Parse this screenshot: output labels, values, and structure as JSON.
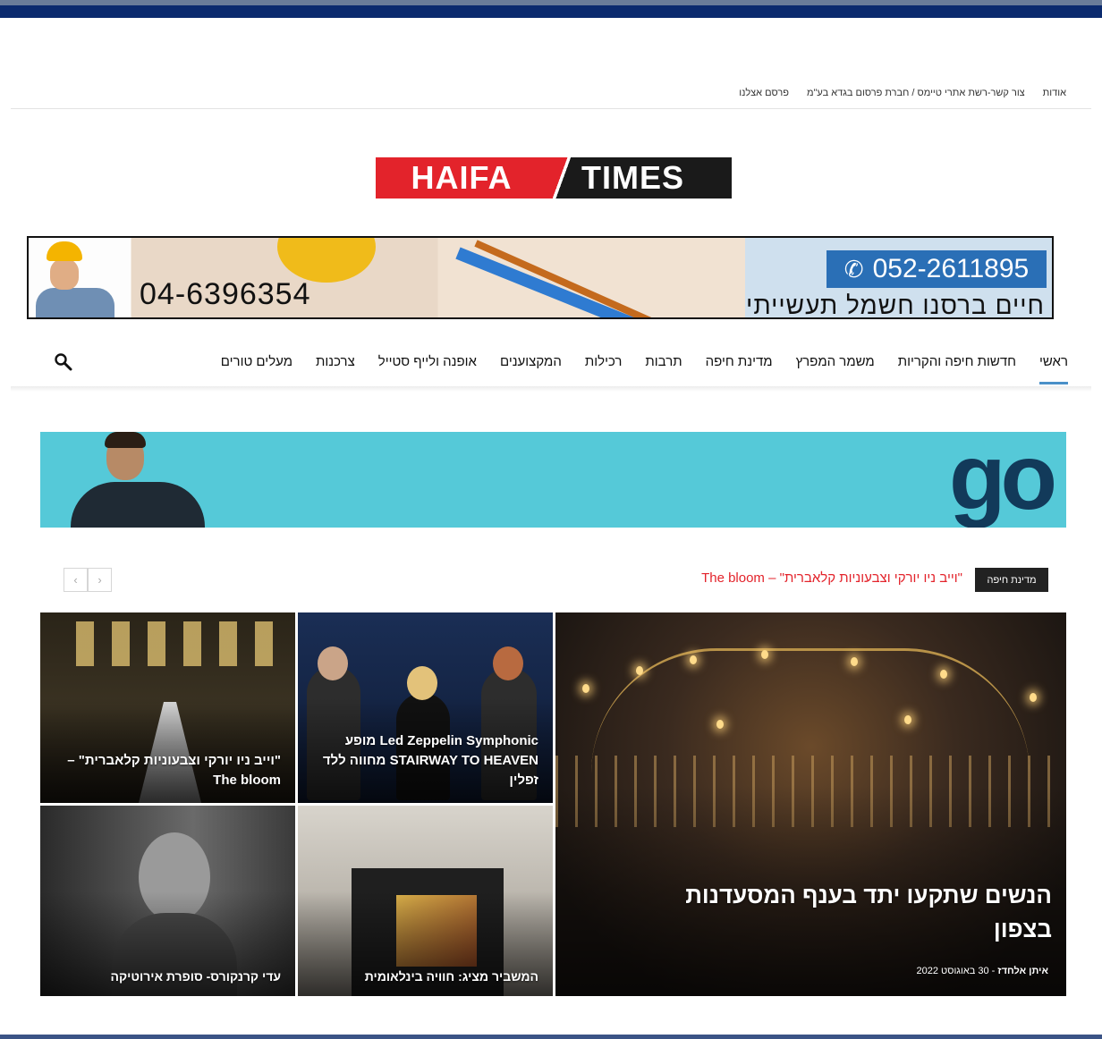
{
  "topmenu": {
    "items": [
      "אודות",
      "צור קשר-רשת אתרי טיימס / חברת פרסום בגדא בע\"מ",
      "פרסם אצלנו"
    ]
  },
  "logo": {
    "left": "HAIFA",
    "right": "TIMES"
  },
  "banner_electric": {
    "phone_left": "04-6396354",
    "phone_right": "052-2611895",
    "name": "חיים ברסנו חשמל תעשייתי"
  },
  "nav": {
    "items": [
      "ראשי",
      "חדשות חיפה והקריות",
      "משמר המפרץ",
      "מדינת חיפה",
      "תרבות",
      "רכילות",
      "המקצוענים",
      "אופנה ולייף סטייל",
      "צרכנות",
      "מעלים טורים"
    ],
    "active_index": 0
  },
  "banner_go": {
    "logo": "go"
  },
  "ticker": {
    "badge": "מדינת חיפה",
    "headline": "\"וייב ניו יורקי וצבעוניות קלאברית\" – The bloom"
  },
  "tiles": {
    "big": {
      "title": "הנשים שתקעו יתד בענף המסעדנות בצפון",
      "author": "איתן אלחדז",
      "date": "30 באוגוסט 2022"
    },
    "lz": {
      "title": "Led Zeppelin Symphonic מופע STAIRWAY TO HEAVEN מחווה ללד זפלין"
    },
    "bloom": {
      "title": "\"וייב ניו יורקי וצבעוניות קלאברית\" – The bloom"
    },
    "shop": {
      "title": "המשביר מציג: חוויה בינלאומית"
    },
    "adi": {
      "title": "עדי קרנקורס- סופרת אירוטיקה"
    }
  },
  "colors": {
    "brand_red": "#e3232b",
    "nav_active": "#4a90c8",
    "navy": "#0b2a6e",
    "go_bg": "#55c9d8"
  }
}
